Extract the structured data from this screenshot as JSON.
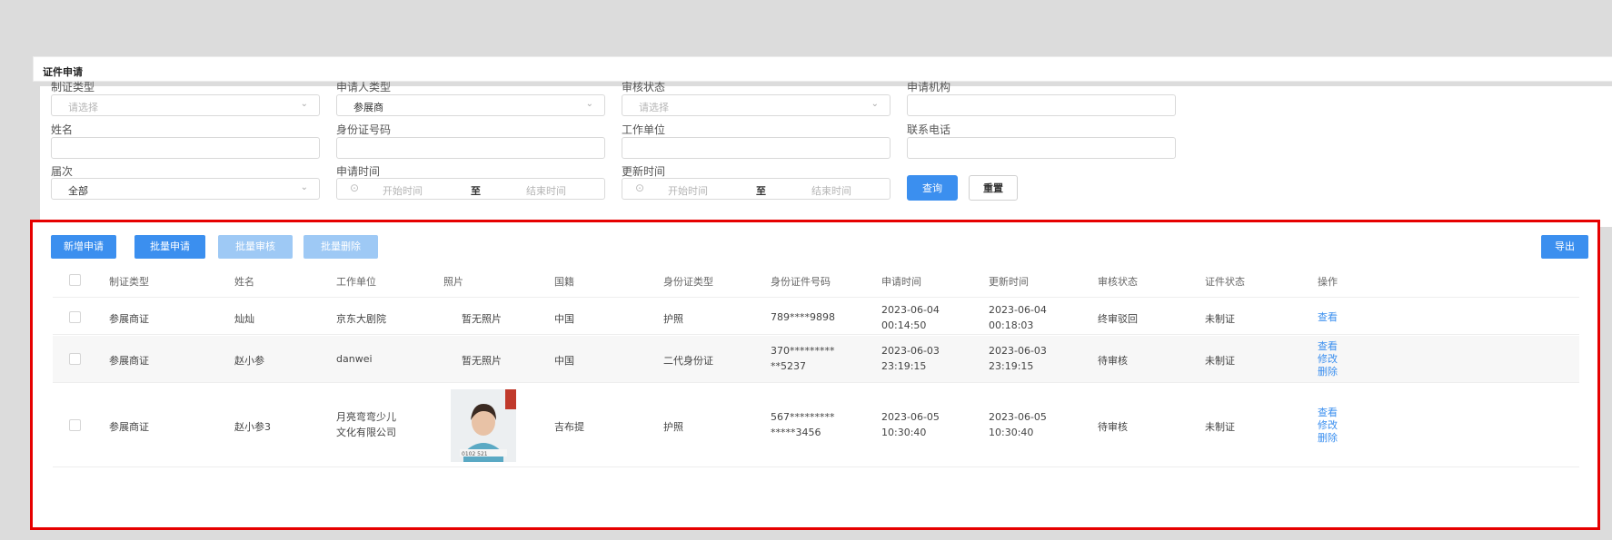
{
  "page_title": "证件申请",
  "filters": {
    "cert_type": {
      "label": "制证类型",
      "placeholder": "请选择"
    },
    "applicant_type": {
      "label": "申请人类型",
      "value": "参展商"
    },
    "review_status": {
      "label": "审核状态",
      "placeholder": "请选择"
    },
    "org": {
      "label": "申请机构"
    },
    "name": {
      "label": "姓名"
    },
    "id_number": {
      "label": "身份证号码"
    },
    "work_unit": {
      "label": "工作单位"
    },
    "phone": {
      "label": "联系电话"
    },
    "session": {
      "label": "届次",
      "value": "全部"
    },
    "apply_time": {
      "label": "申请时间",
      "start": "开始时间",
      "to": "至",
      "end": "结束时间"
    },
    "update_time": {
      "label": "更新时间",
      "start": "开始时间",
      "to": "至",
      "end": "结束时间"
    },
    "query_btn": "查询",
    "reset_btn": "重置"
  },
  "toolbar": {
    "add": "新增申请",
    "batch_apply": "批量申请",
    "batch_review": "批量审核",
    "batch_delete": "批量删除",
    "export": "导出"
  },
  "columns": [
    "制证类型",
    "姓名",
    "工作单位",
    "照片",
    "国籍",
    "身份证类型",
    "身份证件号码",
    "申请时间",
    "更新时间",
    "审核状态",
    "证件状态",
    "操作"
  ],
  "rows": [
    {
      "type": "参展商证",
      "name": "灿灿",
      "unit": [
        "京东大剧院"
      ],
      "photo": "暂无照片",
      "nationality": "中国",
      "id_type": "护照",
      "id_no": [
        "789****9898"
      ],
      "apply": [
        "2023-06-04",
        "00:14:50"
      ],
      "update": [
        "2023-06-04",
        "00:18:03"
      ],
      "review": "终审驳回",
      "status": "未制证",
      "actions": [
        "查看"
      ]
    },
    {
      "type": "参展商证",
      "name": "赵小参",
      "unit": [
        "danwei"
      ],
      "photo": "暂无照片",
      "nationality": "中国",
      "id_type": "二代身份证",
      "id_no": [
        "370*********",
        "**5237"
      ],
      "apply": [
        "2023-06-03",
        "23:19:15"
      ],
      "update": [
        "2023-06-03",
        "23:19:15"
      ],
      "review": "待审核",
      "status": "未制证",
      "actions": [
        "查看",
        "修改",
        "删除"
      ]
    },
    {
      "type": "参展商证",
      "name": "赵小参3",
      "unit": [
        "月亮弯弯少儿",
        "文化有限公司"
      ],
      "photo": "",
      "nationality": "吉布提",
      "id_type": "护照",
      "id_no": [
        "567*********",
        "*****3456"
      ],
      "apply": [
        "2023-06-05",
        "10:30:40"
      ],
      "update": [
        "2023-06-05",
        "10:30:40"
      ],
      "review": "待审核",
      "status": "未制证",
      "actions": [
        "查看",
        "修改",
        "删除"
      ]
    }
  ],
  "photo_caption": "0102 521",
  "colors": {
    "primary": "#3b8fef",
    "disabled": "#9ec9f5",
    "highlight": "#e60000"
  }
}
